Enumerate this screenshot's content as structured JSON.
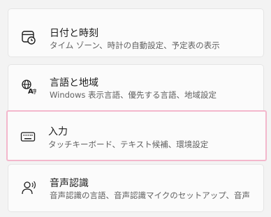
{
  "settings_list": [
    {
      "title": "日付と時刻",
      "subtitle": "タイム ゾーン、時計の自動設定、予定表の表示",
      "icon": "calendar-clock-icon"
    },
    {
      "title": "言語と地域",
      "subtitle": "Windows 表示言語、優先する言語、地域設定",
      "icon": "language-globe-icon"
    },
    {
      "title": "入力",
      "subtitle": "タッチキーボード、テキスト候補、環境設定",
      "icon": "keyboard-icon"
    },
    {
      "title": "音声認識",
      "subtitle": "音声認識の言語、音声認識マイクのセットアップ、音声",
      "icon": "speech-person-icon"
    }
  ],
  "colors": {
    "background": "#f3f3f3",
    "card": "#fbfbfb",
    "highlight_border": "#f3b7cc",
    "title_text": "#1b1b1b",
    "subtitle_text": "#606060"
  }
}
